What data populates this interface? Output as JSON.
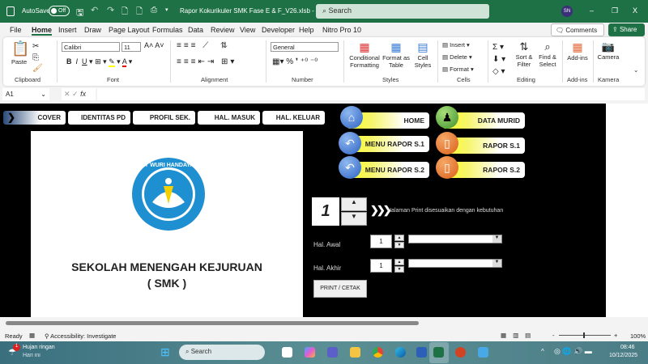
{
  "titlebar": {
    "autosave": "AutoSave",
    "toggle": "Off",
    "filename": "Rapor Kokurikuler SMK Fase E & F_V26.xlsb  -",
    "search": "Search",
    "avatar": "SN",
    "minimize": "–",
    "restore": "❐",
    "close": "X"
  },
  "menu": {
    "items": [
      "File",
      "Home",
      "Insert",
      "Draw",
      "Page Layout",
      "Formulas",
      "Data",
      "Review",
      "View",
      "Developer",
      "Help",
      "Nitro Pro 10"
    ],
    "comments": "Comments",
    "share": "Share"
  },
  "ribbon": {
    "paste": "Paste",
    "font_name": "Calibri",
    "font_size": "11",
    "number_format": "General",
    "conditional": "Conditional Formatting",
    "format_table": "Format as Table",
    "cell_styles": "Cell Styles",
    "insert": "Insert",
    "delete": "Delete",
    "format": "Format",
    "sort": "Sort & Filter",
    "find": "Find & Select",
    "addins": "Add-ins",
    "camera": "Camera",
    "groups": [
      "Clipboard",
      "Font",
      "Alignment",
      "Number",
      "Styles",
      "Cells",
      "Editing",
      "Add-ins",
      "Kamera"
    ]
  },
  "formula": {
    "cell_ref": "A1",
    "fx": "fx",
    "value": ""
  },
  "sheet": {
    "nav": [
      "COVER",
      "IDENTITAS PD",
      "PROFIL SEK.",
      "HAL. MASUK",
      "HAL. KELUAR"
    ],
    "buttons": {
      "home": "HOME",
      "data_murid": "DATA MURID",
      "menu_s1": "MENU RAPOR S.1",
      "rapor_s1": "RAPOR S.1",
      "menu_s2": "MENU RAPOR S.2",
      "rapor_s2": "RAPOR S.2"
    },
    "logo_text": "TUT WURI HANDAYANI",
    "school_line1": "SEKOLAH MENENGAH KEJURUAN",
    "school_line2": "( SMK )",
    "page_value": "1",
    "print_hint": "Halaman Print disesuaikan dengan kebutuhan",
    "hal_awal_label": "Hal. Awal",
    "hal_awal_value": "1",
    "hal_akhir_label": "Hal. Akhir",
    "hal_akhir_value": "1",
    "print_button": "PRINT / CETAK"
  },
  "status": {
    "ready": "Ready",
    "accessibility": "Accessibility: Investigate",
    "zoom": "100%"
  },
  "taskbar": {
    "weather_title": "Hujan ringan",
    "weather_sub": "Hari ini",
    "badge": "1",
    "search": "Search",
    "time": "08:46",
    "date": "10/12/2025"
  }
}
